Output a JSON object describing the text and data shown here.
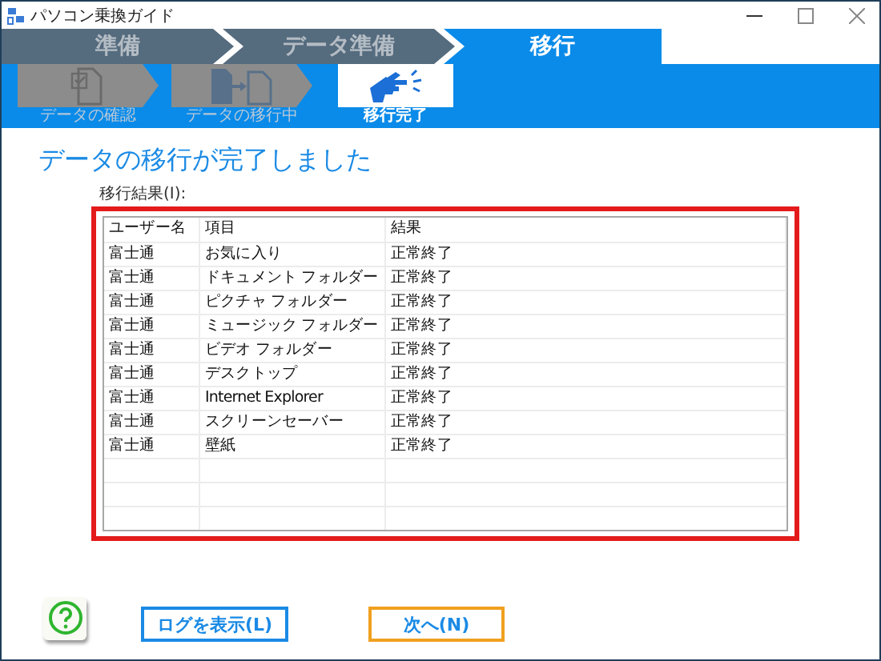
{
  "window": {
    "title": "パソコン乗換ガイド"
  },
  "steps": [
    {
      "label": "準備",
      "selected": false
    },
    {
      "label": "データ準備",
      "selected": false
    },
    {
      "label": "移行",
      "selected": true
    }
  ],
  "substeps": [
    {
      "label": "データの確認",
      "selected": false,
      "kind": "check"
    },
    {
      "label": "データの移行中",
      "selected": false,
      "kind": "copy"
    },
    {
      "label": "移行完了",
      "selected": true,
      "kind": "done"
    }
  ],
  "heading": "データの移行が完了しました",
  "results_label": "移行結果(I):",
  "table": {
    "columns": [
      "ユーザー名",
      "項目",
      "結果"
    ],
    "rows": [
      [
        "富士通",
        "お気に入り",
        "正常終了"
      ],
      [
        "富士通",
        "ドキュメント フォルダー",
        "正常終了"
      ],
      [
        "富士通",
        "ピクチャ フォルダー",
        "正常終了"
      ],
      [
        "富士通",
        "ミュージック フォルダー",
        "正常終了"
      ],
      [
        "富士通",
        "ビデオ フォルダー",
        "正常終了"
      ],
      [
        "富士通",
        "デスクトップ",
        "正常終了"
      ],
      [
        "富士通",
        "Internet Explorer",
        "正常終了"
      ],
      [
        "富士通",
        "スクリーンセーバー",
        "正常終了"
      ],
      [
        "富士通",
        "壁紙",
        "正常終了"
      ]
    ]
  },
  "buttons": {
    "log": "ログを表示(L)",
    "next": "次へ(N)"
  }
}
